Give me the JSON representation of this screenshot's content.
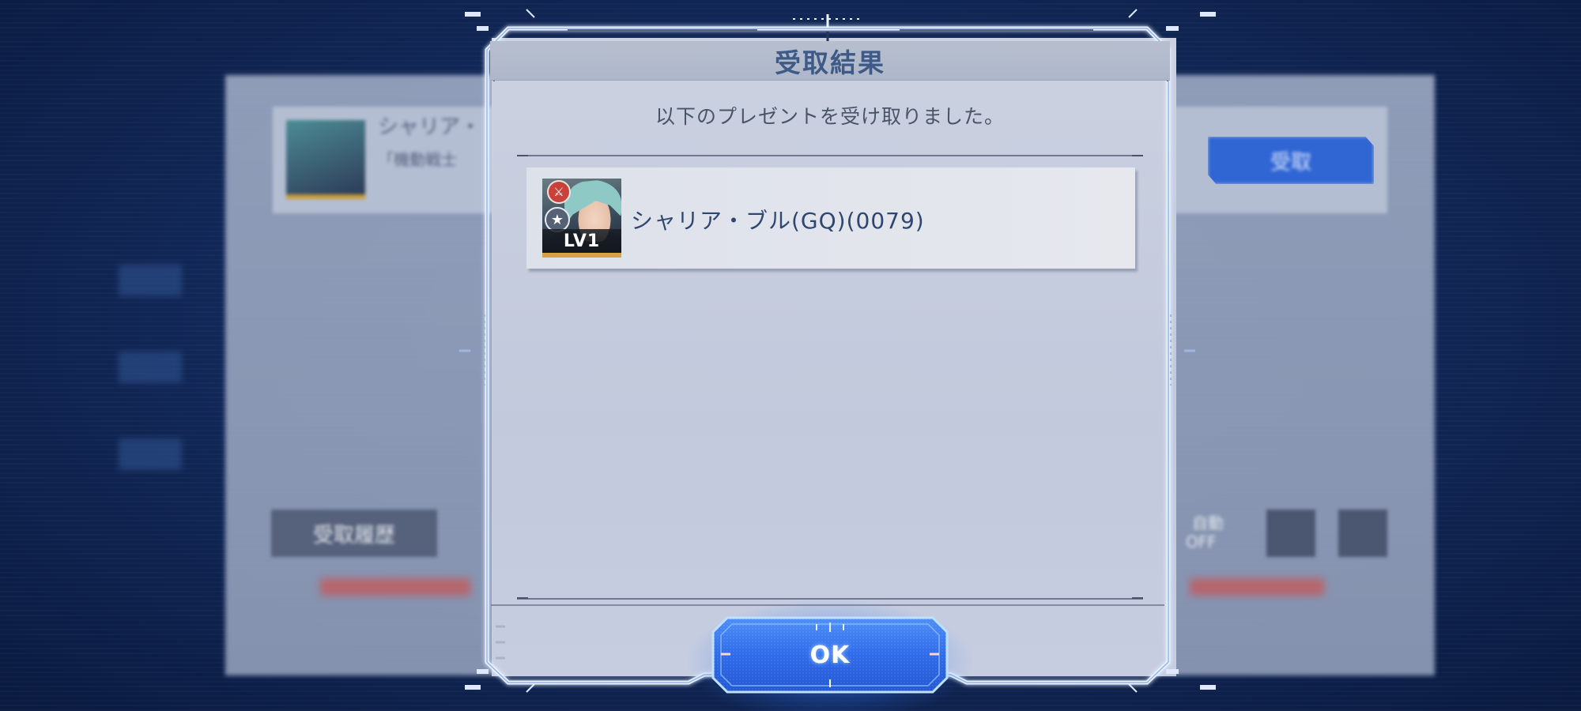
{
  "dialog": {
    "title": "受取結果",
    "message": "以下のプレゼントを受け取りました。",
    "ok_label": "OK"
  },
  "received_items": [
    {
      "name": "シャリア・ブル(GQ)(0079)",
      "level": "LV1",
      "role_icon": "sword-icon",
      "rank_icon": "star-medal-icon"
    }
  ],
  "background": {
    "card_title": "シャリア・",
    "card_subtitle": "「機動戦士",
    "receive_button": "受取",
    "history_button": "受取履歴",
    "auto_toggle_label": "自動",
    "auto_toggle_state": "OFF"
  },
  "colors": {
    "title_text": "#3e5a86",
    "panel_bg": "#c6cde0",
    "ok_button": "#2f6bea",
    "accent_glow": "#7fc4ff"
  }
}
